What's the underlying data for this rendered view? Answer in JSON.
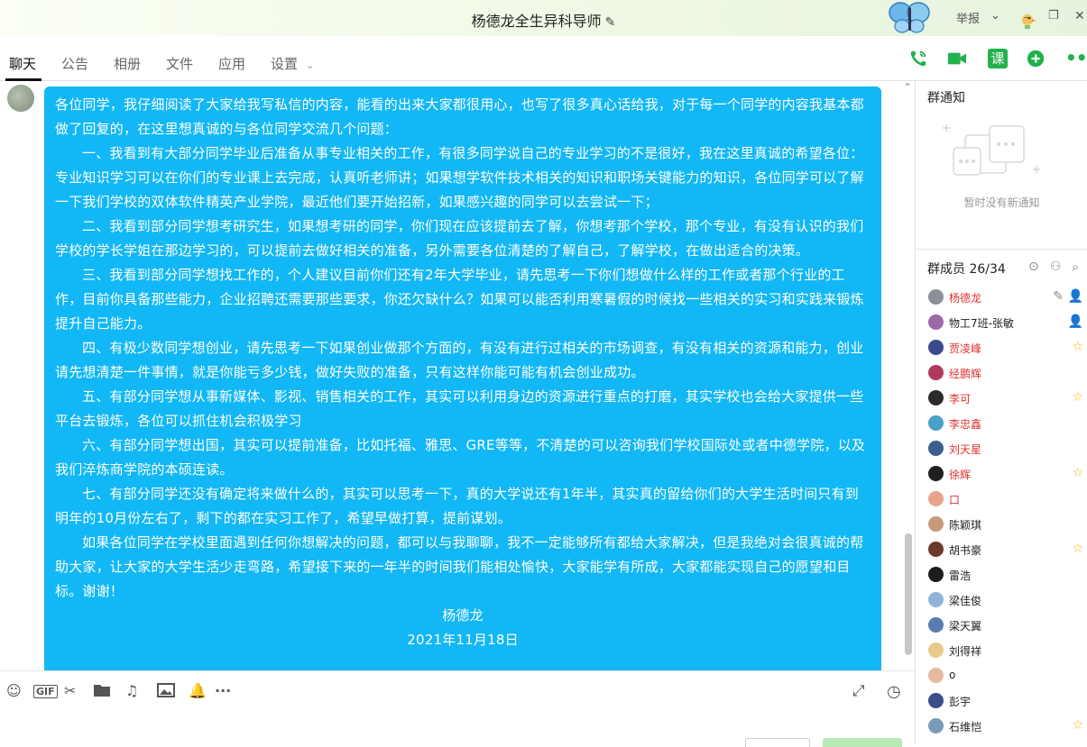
{
  "window": {
    "title": "杨德龙全生异科导师",
    "report_label": "举报"
  },
  "tabs": [
    "聊天",
    "公告",
    "相册",
    "文件",
    "应用",
    "设置"
  ],
  "toolbar": {
    "course_label": "课"
  },
  "message": {
    "paragraphs": [
      "各位同学，我仔细阅读了大家给我写私信的内容，能看的出来大家都很用心，也写了很多真心话给我，对于每一个同学的内容我基本都做了回复的，在这里想真诚的与各位同学交流几个问题：",
      "一、我看到有大部分同学毕业后准备从事专业相关的工作，有很多同学说自己的专业学习的不是很好，我在这里真诚的希望各位：专业知识学习可以在你们的专业课上去完成，认真听老师讲；如果想学软件技术相关的知识和职场关键能力的知识，各位同学可以了解一下我们学校的双体软件精英产业学院，最近他们要开始招新，如果感兴趣的同学可以去尝试一下；",
      "二、我看到部分同学想考研究生，如果想考研的同学，你们现在应该提前去了解，你想考那个学校，那个专业，有没有认识的我们学校的学长学姐在那边学习的，可以提前去做好相关的准备，另外需要各位清楚的了解自己，了解学校，在做出适合的决策。",
      "三、我看到部分同学想找工作的，个人建议目前你们还有2年大学毕业，请先思考一下你们想做什么样的工作或者那个行业的工作，目前你具备那些能力，企业招聘还需要那些要求，你还欠缺什么？如果可以能否利用寒暑假的时候找一些相关的实习和实践来锻炼提升自己能力。",
      "四、有极少数同学想创业，请先思考一下如果创业做那个方面的，有没有进行过相关的市场调查，有没有相关的资源和能力，创业请先想清楚一件事情，就是你能亏多少钱，做好失败的准备，只有这样你能可能有机会创业成功。",
      "五、有部分同学想从事新媒体、影视、销售相关的工作，其实可以利用身边的资源进行重点的打磨，其实学校也会给大家提供一些平台去锻炼，各位可以抓住机会积极学习",
      "六、有部分同学想出国，其实可以提前准备，比如托福、雅思、GRE等等，不清楚的可以咨询我们学校国际处或者中德学院，以及我们淬炼商学院的本硕连读。",
      "七、有部分同学还没有确定将来做什么的，其实可以思考一下，真的大学说还有1年半，其实真的留给你们的大学生活时间只有到明年的10月份左右了，剩下的都在实习工作了，希望早做打算，提前谋划。",
      "如果各位同学在学校里面遇到任何你想解决的问题，都可以与我聊聊，我不一定能够所有都给大家解决，但是我绝对会很真诚的帮助大家，让大家的大学生活少走弯路，希望接下来的一年半的时间我们能相处愉快，大家能学有所成，大家都能实现自己的愿望和目标。谢谢！"
    ],
    "signature": "杨德龙",
    "date": "2021年11月18日"
  },
  "notice": {
    "title": "群通知",
    "empty_text": "暂时没有新通知"
  },
  "members": {
    "title": "群成员 26/34",
    "list": [
      {
        "name": "杨德龙",
        "color": "#e0332f",
        "badge": "owner",
        "av": "#8a8f98"
      },
      {
        "name": "物工7班-张敏",
        "color": "#222222",
        "badge": "admin",
        "av": "#9b6aa7"
      },
      {
        "name": "贾凌峰",
        "color": "#e0332f",
        "badge": "star",
        "av": "#3b4a8c"
      },
      {
        "name": "经鹏辉",
        "color": "#e0332f",
        "badge": "",
        "av": "#b23b5d"
      },
      {
        "name": "李可",
        "color": "#e0332f",
        "badge": "star",
        "av": "#2a2a2a"
      },
      {
        "name": "李忠鑫",
        "color": "#e0332f",
        "badge": "",
        "av": "#4aa0c9"
      },
      {
        "name": "刘天星",
        "color": "#e0332f",
        "badge": "",
        "av": "#3c5f8e"
      },
      {
        "name": "徐辉",
        "color": "#e0332f",
        "badge": "star",
        "av": "#1f1f1f"
      },
      {
        "name": "口",
        "color": "#e0332f",
        "badge": "",
        "av": "#e9a38c"
      },
      {
        "name": "陈颖琪",
        "color": "#222222",
        "badge": "",
        "av": "#c49a7a"
      },
      {
        "name": "胡书豪",
        "color": "#222222",
        "badge": "star",
        "av": "#6b3a2a"
      },
      {
        "name": "雷浩",
        "color": "#222222",
        "badge": "",
        "av": "#1c1c1c"
      },
      {
        "name": "梁佳俊",
        "color": "#222222",
        "badge": "",
        "av": "#8fb4d6"
      },
      {
        "name": "梁天翼",
        "color": "#222222",
        "badge": "",
        "av": "#5a7bb0"
      },
      {
        "name": "刘得祥",
        "color": "#222222",
        "badge": "",
        "av": "#e8c98a"
      },
      {
        "name": "o",
        "color": "#222222",
        "badge": "",
        "av": "#e7b9a2"
      },
      {
        "name": "彭宇",
        "color": "#222222",
        "badge": "",
        "av": "#3a4c8a"
      },
      {
        "name": "石维恺",
        "color": "#222222",
        "badge": "star",
        "av": "#7a9ab8"
      }
    ]
  }
}
